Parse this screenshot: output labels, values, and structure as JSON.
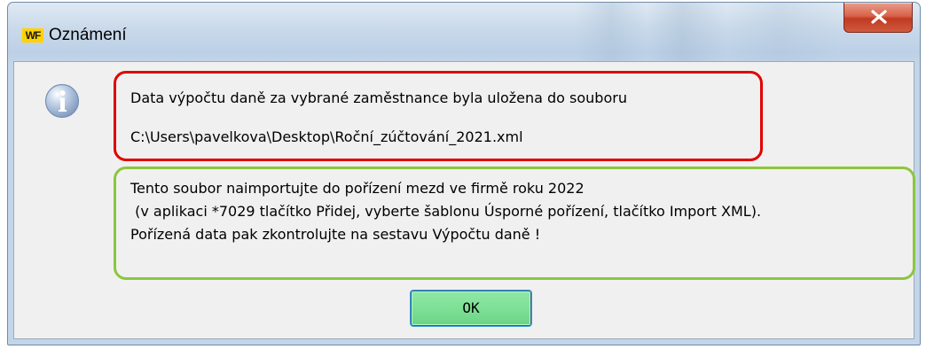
{
  "window": {
    "app_icon_text": "WF",
    "title": "Oznámení",
    "close_icon": "close-x-icon"
  },
  "message": {
    "icon": "info-icon",
    "red_box": {
      "line1": "Data výpočtu daně za vybrané zaměstnance byla uložena do souboru",
      "line2": "C:\\Users\\pavelkova\\Desktop\\Roční_zúčtování_2021.xml"
    },
    "green_box": {
      "line1": "Tento soubor naimportujte do pořízení mezd ve firmě roku 2022",
      "line2": " (v aplikaci *7029 tlačítko Přidej, vyberte šablonu Úsporné pořízení, tlačítko Import XML).",
      "line3": "Pořízená data pak zkontrolujte na sestavu Výpočtu daně !"
    }
  },
  "buttons": {
    "ok_label": "OK"
  },
  "colors": {
    "red_highlight": "#e00000",
    "green_highlight": "#8cc63e",
    "ok_button": "#7ee096",
    "close_button": "#c9472d"
  }
}
